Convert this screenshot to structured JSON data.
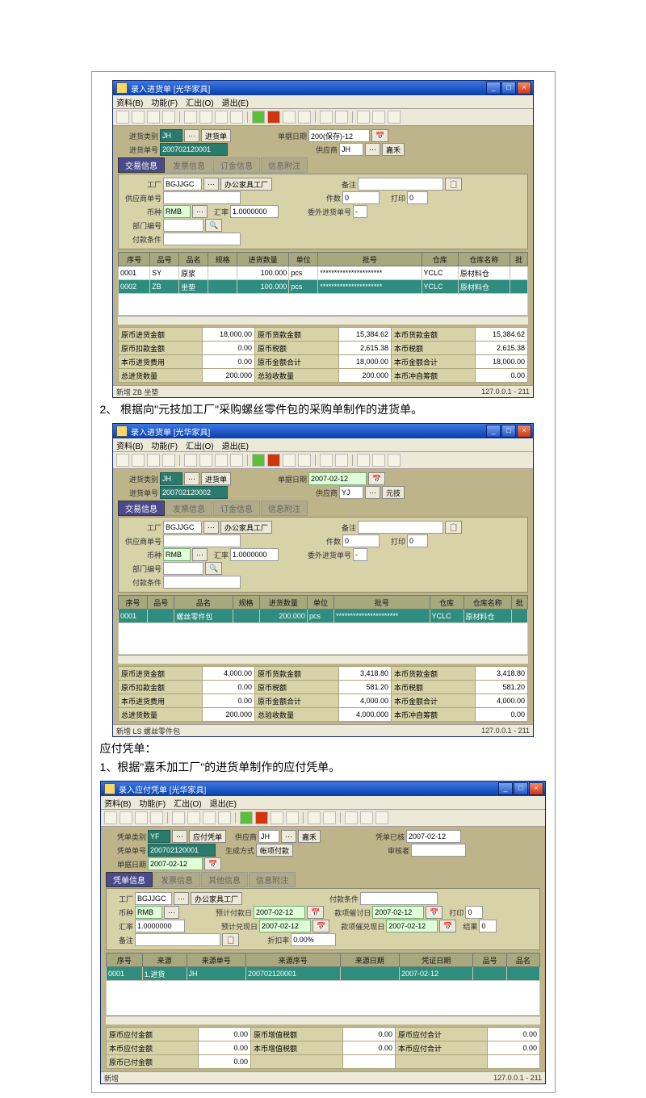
{
  "shot1": {
    "title": "录入进货单 [光华家具]",
    "menus": [
      "资料(B)",
      "功能(F)",
      "汇出(O)",
      "退出(E)"
    ],
    "header": {
      "cat_lbl": "进货类别",
      "cat_val": "JH",
      "doc_btn": "进货单",
      "date_lbl": "单据日期",
      "date_val": "200(保存)-12",
      "num_lbl": "进货单号",
      "num_val": "200702120001",
      "sup_lbl": "供应商",
      "sup_val": "JH",
      "sup_name": "嘉禾"
    },
    "tabs": [
      "交易信息",
      "发票信息",
      "订金信息",
      "信息附注"
    ],
    "form": {
      "fac_lbl": "工厂",
      "fac_val": "BGJJGC",
      "fac_name": "办公家具工厂",
      "remark_lbl": "备注",
      "supdoc_lbl": "供应商单号",
      "qty_lbl": "件数",
      "qty_val": "0",
      "print_lbl": "打印",
      "print_val": "0",
      "curr_lbl": "币种",
      "curr_val": "RMB",
      "rate_lbl": "汇率",
      "rate_val": "1.0000000",
      "ref_lbl": "委外进货单号",
      "ref_val": "-",
      "dept_lbl": "部门编号",
      "pay_lbl": "付款条件"
    },
    "cols": [
      "序号",
      "品号",
      "品名",
      "规格",
      "进货数量",
      "单位",
      "批号",
      "仓库",
      "仓库名称",
      "批"
    ],
    "rows": [
      [
        "0001",
        "SY",
        "原浆",
        "",
        "100.000",
        "pcs",
        "**********************",
        "YCLC",
        "原材料仓",
        ""
      ],
      [
        "0002",
        "ZB",
        "坐垫",
        "",
        "100.000",
        "pcs",
        "**********************",
        "YCLC",
        "原材料仓",
        ""
      ]
    ],
    "totals": {
      "r1": [
        "原币进货金额",
        "18,000.00",
        "原币货款金额",
        "15,384.62",
        "本币货款金额",
        "15,384.62"
      ],
      "r2": [
        "原币扣款金额",
        "0.00",
        "原币税额",
        "2,615.38",
        "本币税额",
        "2,615.38"
      ],
      "r3": [
        "本币进货费用",
        "0.00",
        "原币金额合计",
        "18,000.00",
        "本币金额合计",
        "18,000.00"
      ],
      "r4": [
        "总进货数量",
        "200.000",
        "总验收数量",
        "200.000",
        "本币冲自筹额",
        "0.00"
      ]
    },
    "status_left": "新增  ZB 坐垫",
    "status_right": "127.0.0.1 - 211"
  },
  "text1": "2、 根据向\"元技加工厂\"采购螺丝零件包的采购单制作的进货单。",
  "shot2": {
    "title": "录入进货单 [光华家具]",
    "menus": [
      "资料(B)",
      "功能(F)",
      "汇出(O)",
      "退出(E)"
    ],
    "header": {
      "cat_lbl": "进货类别",
      "cat_val": "JH",
      "doc_btn": "进货单",
      "date_lbl": "单据日期",
      "date_val": "2007-02-12",
      "num_lbl": "进货单号",
      "num_val": "200702120002",
      "sup_lbl": "供应商",
      "sup_val": "YJ",
      "sup_name": "元技"
    },
    "tabs": [
      "交易信息",
      "发票信息",
      "订金信息",
      "信息附注"
    ],
    "form": {
      "fac_lbl": "工厂",
      "fac_val": "BGJJGC",
      "fac_name": "办公家具工厂",
      "remark_lbl": "备注",
      "supdoc_lbl": "供应商单号",
      "qty_lbl": "件数",
      "qty_val": "0",
      "print_lbl": "打印",
      "print_val": "0",
      "curr_lbl": "币种",
      "curr_val": "RMB",
      "rate_lbl": "汇率",
      "rate_val": "1.0000000",
      "ref_lbl": "委外进货单号",
      "ref_val": "-",
      "dept_lbl": "部门编号",
      "pay_lbl": "付款条件"
    },
    "cols": [
      "序号",
      "品号",
      "品名",
      "规格",
      "进货数量",
      "单位",
      "批号",
      "仓库",
      "仓库名称",
      "批"
    ],
    "rows": [
      [
        "0001",
        "",
        "螺丝零件包",
        "",
        "200.000",
        "pcs",
        "**********************",
        "YCLC",
        "原材料仓",
        ""
      ]
    ],
    "totals": {
      "r1": [
        "原币进货金额",
        "4,000.00",
        "原币货款金额",
        "3,418.80",
        "本币货款金额",
        "3,418.80"
      ],
      "r2": [
        "原币扣款金额",
        "0.00",
        "原币税额",
        "581.20",
        "本币税额",
        "581.20"
      ],
      "r3": [
        "本币进货费用",
        "0.00",
        "原币金额合计",
        "4,000.00",
        "本币金额合计",
        "4,000.00"
      ],
      "r4": [
        "总进货数量",
        "200.000",
        "总验收数量",
        "4,000.000",
        "本币冲自筹额",
        "0.00"
      ]
    },
    "status_left": "新增  LS 螺丝零件包",
    "status_right": "127.0.0.1 - 211"
  },
  "text2a": "应付凭单：",
  "text2b": "1、根据\"嘉禾加工厂\"的进货单制作的应付凭单。",
  "shot3": {
    "title": "录入应付凭单 [光华家具]",
    "menus": [
      "资料(B)",
      "功能(F)",
      "汇出(O)",
      "退出(E)"
    ],
    "header": {
      "cat_lbl": "凭单类别",
      "cat_val": "YF",
      "doc_btn": "应付凭单",
      "sup_lbl": "供应商",
      "sup_val": "JH",
      "sup_name": "嘉禾",
      "date_ok_lbl": "凭单已核",
      "date_ok_val": "2007-02-12",
      "num_lbl": "凭单单号",
      "num_val": "200702120001",
      "doc_date_lbl": "单据日期",
      "doc_date_val": "2007-02-12",
      "gen_lbl": "生成方式",
      "gen_val": "帐项付款",
      "aud_lbl": "审核者"
    },
    "tabs": [
      "凭单信息",
      "发票信息",
      "其他信息",
      "信息附注"
    ],
    "form": {
      "fac_lbl": "工厂",
      "fac_val": "BGJJGC",
      "fac_name": "办公家具工厂",
      "pay_lbl": "付款条件",
      "curr_lbl": "币种",
      "curr_val": "RMB",
      "pre_pay_lbl": "预计付款日",
      "pre_pay_val": "2007-02-12",
      "reminder_lbl": "款项催讨日",
      "reminder_val": "2007-02-12",
      "print_lbl": "打印",
      "print_val": "0",
      "rate_lbl": "汇率",
      "rate_val": "1.0000000",
      "cash_date_lbl": "预计兑现日",
      "cash_date_val": "2007-02-12",
      "reminder2_lbl": "款项催兑现日",
      "reminder2_val": "2007-02-12",
      "result_lbl": "结果",
      "result_val": "0",
      "remark_lbl": "备注",
      "discrate_lbl": "折扣率",
      "discrate_val": "0.00%"
    },
    "cols": [
      "序号",
      "来源",
      "来源单号",
      "来源序号",
      "来源日期",
      "凭证日期",
      "品号",
      "品名"
    ],
    "rows": [
      [
        "0001",
        "1.进货",
        "JH   ",
        "200702120001",
        "",
        "2007-02-12",
        "",
        "",
        ""
      ]
    ],
    "totals": {
      "r1": [
        "原币应付金额",
        "0.00",
        "原币增值税额",
        "0.00",
        "原币应付合计",
        "0.00"
      ],
      "r2": [
        "本币应付金额",
        "0.00",
        "本币增值税额",
        "0.00",
        "本币应付合计",
        "0.00"
      ],
      "r3": [
        "原币已付金额",
        "0.00",
        "",
        "",
        "",
        ""
      ]
    },
    "status_left": "新增",
    "status_right": "127.0.0.1 - 211"
  }
}
